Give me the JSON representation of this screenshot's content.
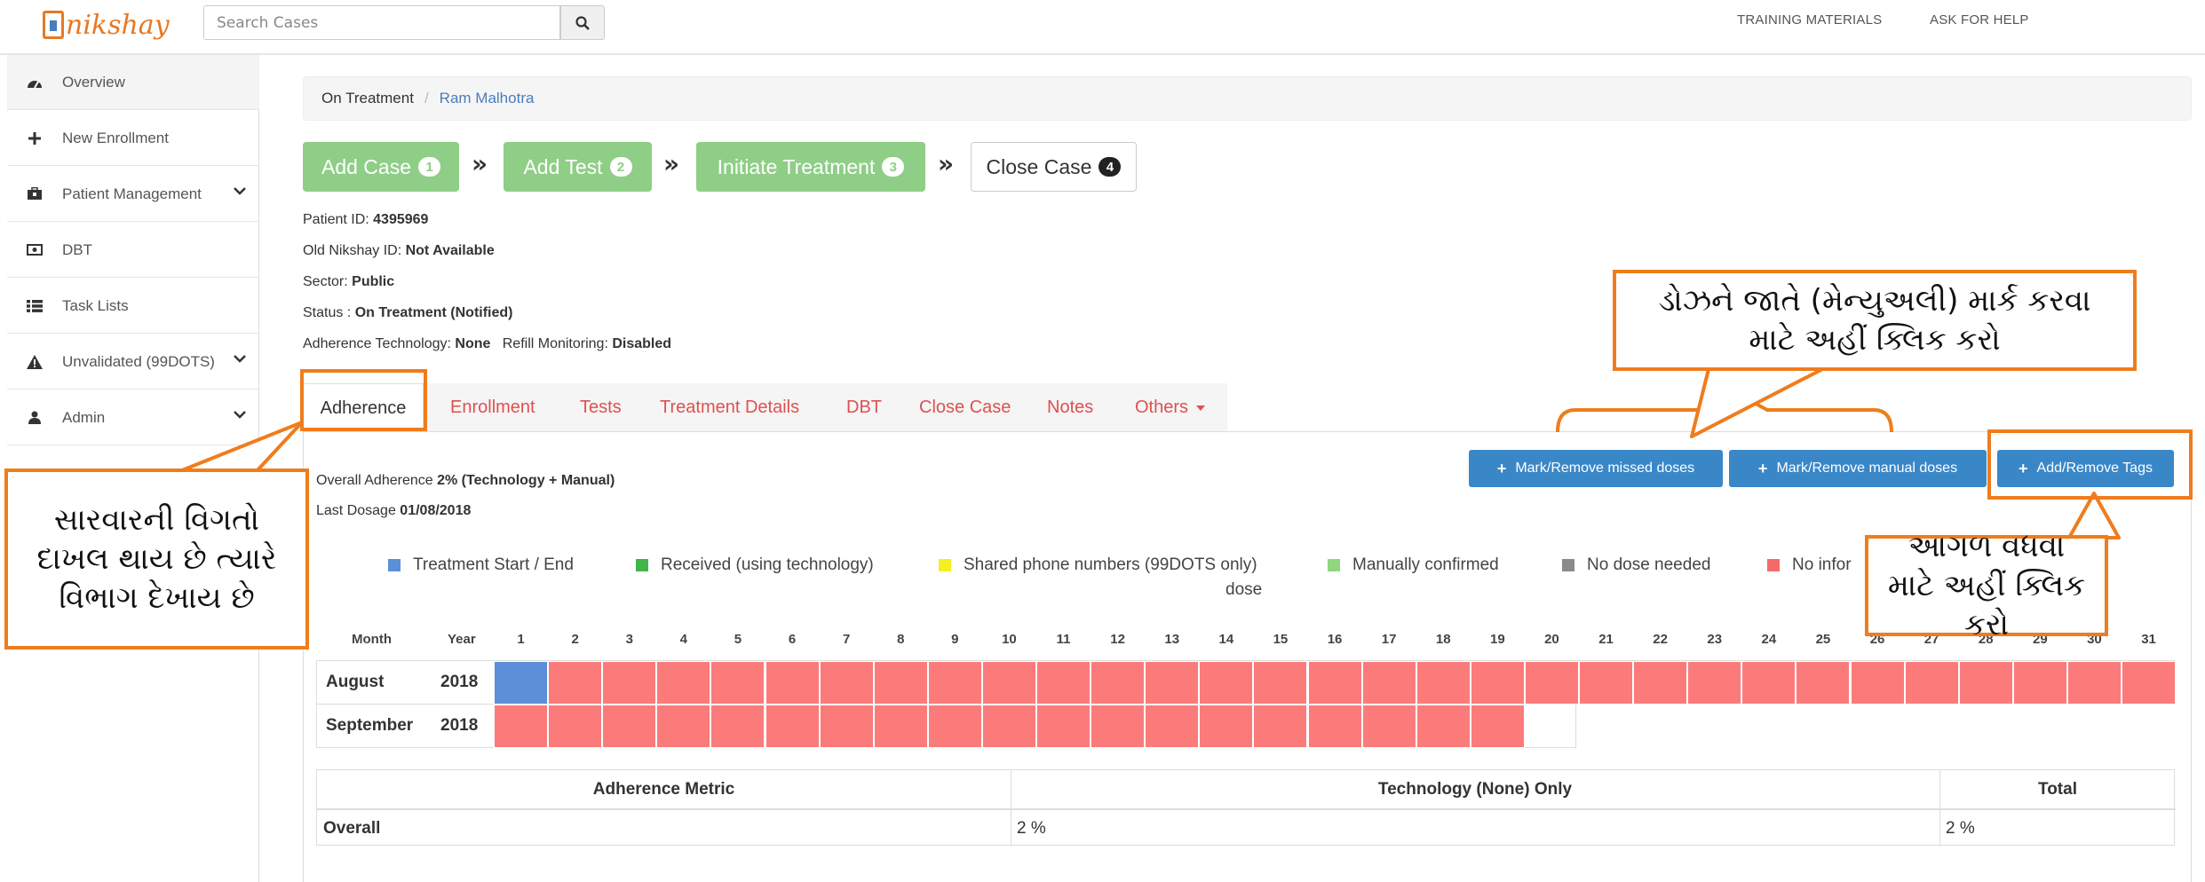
{
  "brand": {
    "name": "nikshay"
  },
  "search": {
    "placeholder": "Search Cases"
  },
  "topnav": {
    "training": "TRAINING MATERIALS",
    "help": "ASK FOR HELP"
  },
  "sidebar": {
    "items": [
      {
        "label": "Overview",
        "icon": "dashboard-icon"
      },
      {
        "label": "New Enrollment",
        "icon": "plus-icon"
      },
      {
        "label": "Patient Management",
        "icon": "briefcase-icon"
      },
      {
        "label": "DBT",
        "icon": "money-icon"
      },
      {
        "label": "Task Lists",
        "icon": "list-icon"
      },
      {
        "label": "Unvalidated (99DOTS)",
        "icon": "warning-icon"
      },
      {
        "label": "Admin",
        "icon": "user-icon"
      }
    ]
  },
  "breadcrumb": {
    "parent": "On Treatment",
    "separator": "/",
    "current": "Ram Malhotra"
  },
  "steps": [
    {
      "label": "Add Case",
      "num": "1"
    },
    {
      "label": "Add Test",
      "num": "2"
    },
    {
      "label": "Initiate Treatment",
      "num": "3"
    },
    {
      "label": "Close Case",
      "num": "4"
    }
  ],
  "step_arrow": "»",
  "patient": {
    "id_label": "Patient ID:",
    "id_value": "4395969",
    "old_label": "Old Nikshay ID:",
    "old_value": "Not Available",
    "sector_label": "Sector:",
    "sector_value": "Public",
    "status_label": "Status :",
    "status_value": "On Treatment (Notified)",
    "adh_tech_label": "Adherence Technology:",
    "adh_tech_value": "None",
    "refill_label": "Refill Monitoring:",
    "refill_value": "Disabled"
  },
  "tabs": [
    "Adherence",
    "Enrollment",
    "Tests",
    "Treatment Details",
    "DBT",
    "Close Case",
    "Notes",
    "Others"
  ],
  "adherence": {
    "overall_label": "Overall Adherence",
    "overall_value": "2% (Technology + Manual)",
    "last_label": "Last Dosage",
    "last_value": "01/08/2018"
  },
  "buttons": {
    "missed": "Mark/Remove missed doses",
    "manual": "Mark/Remove manual doses",
    "tags": "Add/Remove Tags"
  },
  "legend": [
    {
      "label": "Treatment Start / End",
      "color": "#5b8fd8"
    },
    {
      "label": "Received (using technology)",
      "color": "#3fb54a"
    },
    {
      "label": "Shared phone numbers (99DOTS only)",
      "color": "#f5f020"
    },
    {
      "label": "Manually confirmed",
      "color": "#8fd67f"
    },
    {
      "label": "No dose needed",
      "color": "#8a8a8a"
    },
    {
      "label": "No infor",
      "color": "#f56b6b"
    }
  ],
  "legend_wrap": "dose",
  "calendar": {
    "month_header": "Month",
    "year_header": "Year",
    "days": [
      "1",
      "2",
      "3",
      "4",
      "5",
      "6",
      "7",
      "8",
      "9",
      "10",
      "11",
      "12",
      "13",
      "14",
      "15",
      "16",
      "17",
      "18",
      "19",
      "20",
      "21",
      "22",
      "23",
      "24",
      "25",
      "26",
      "27",
      "28",
      "29",
      "30",
      "31"
    ],
    "rows": [
      {
        "month": "August",
        "year": "2018",
        "days_shown": 31,
        "start_day_color": "#5b8fd8"
      },
      {
        "month": "September",
        "year": "2018",
        "days_shown": 19
      }
    ],
    "miss_color": "#fb7b7b"
  },
  "metrics": {
    "headers": [
      "Adherence Metric",
      "Technology (None) Only",
      "Total"
    ],
    "row": [
      "Overall",
      "2 %",
      "2 %"
    ]
  },
  "annotations": {
    "tab_note": "સારવારની વિગતો દાખલ થાય છે ત્યારે વિભાગ દેખાય છે",
    "manual_note": "ડોઝને જાતે (મેન્યુઅલી) માર્ક કરવા માટે અહીં ક્લિક કરો",
    "tags_note": "આગળ વધવા માટે અહીં ક્લિક કરો",
    "accent": "#f07c1c"
  }
}
